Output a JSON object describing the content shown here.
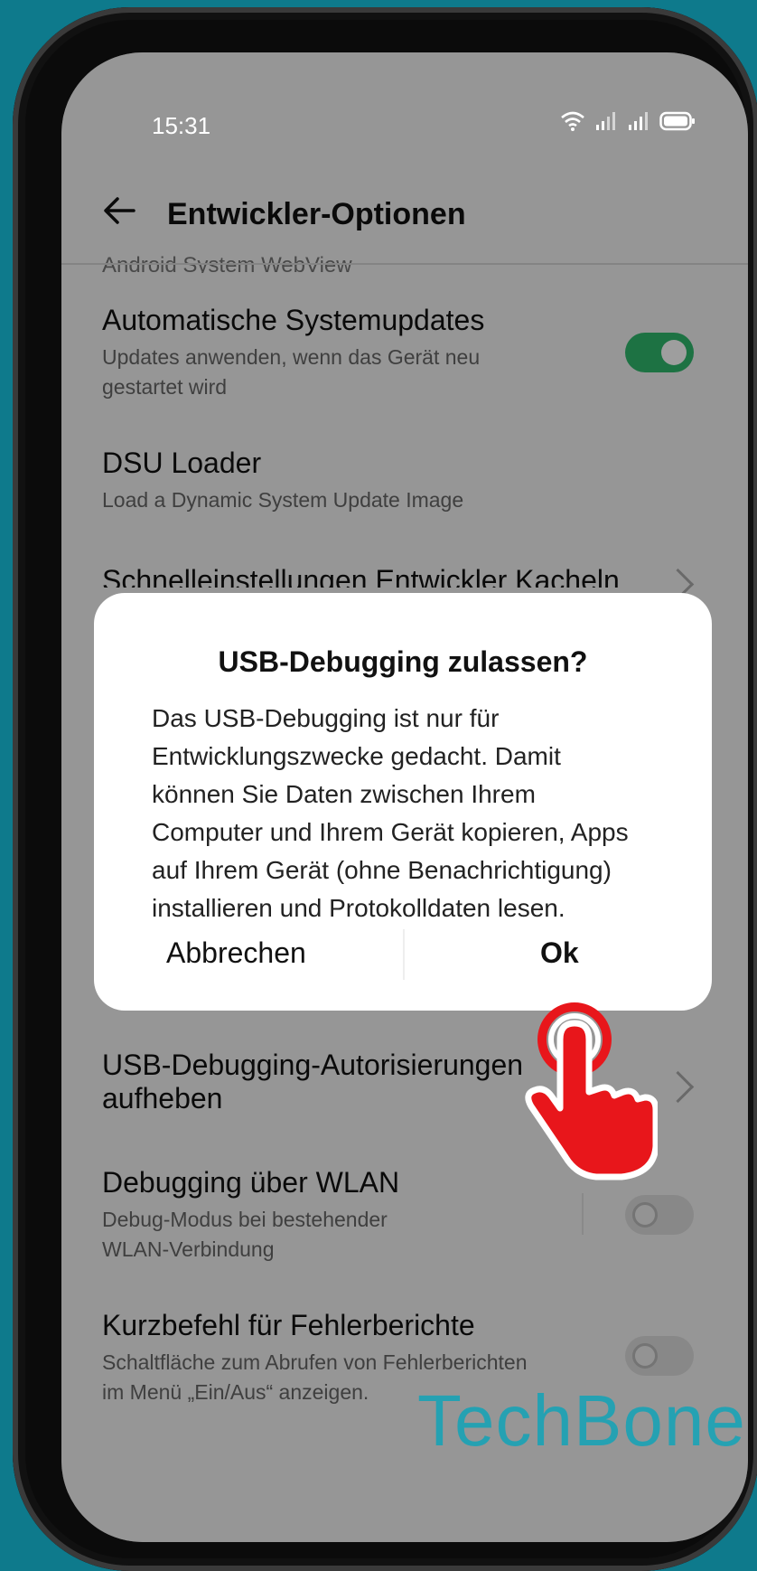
{
  "status_bar": {
    "time": "15:31"
  },
  "app_bar": {
    "title": "Entwickler-Optionen"
  },
  "behind_dialog": {
    "cut_label": "Android System WebView",
    "auto_updates": {
      "title": "Automatische Systemupdates",
      "subtitle_1": "Updates anwenden, wenn das Gerät neu",
      "subtitle_2": "gestartet wird",
      "state": "on"
    },
    "dsu": {
      "title": "DSU Loader",
      "subtitle": "Load a Dynamic System Update Image"
    },
    "quick_tiles": {
      "title": "Schnelleinstellungen Entwickler Kacheln"
    },
    "usb_revoke": {
      "title_1": "USB-Debugging-Autorisierungen",
      "title_2": "aufheben"
    },
    "wlan_debug": {
      "title": "Debugging über WLAN",
      "subtitle_1": "Debug-Modus bei bestehender",
      "subtitle_2": "WLAN-Verbindung",
      "state": "off"
    },
    "bugreport": {
      "title": "Kurzbefehl für Fehlerberichte",
      "subtitle_1": "Schaltfläche zum Abrufen von Fehlerberichten",
      "subtitle_2": "im Menü „Ein/Aus“ anzeigen.",
      "state": "off"
    }
  },
  "dialog": {
    "title": "USB-Debugging zulassen?",
    "body_lines": [
      "Das USB-Debugging ist nur für",
      "Entwicklungszwecke gedacht. Damit",
      "können Sie Daten zwischen Ihrem",
      "Computer und Ihrem Gerät kopieren, Apps",
      "auf Ihrem Gerät (ohne Benachrichtigung)",
      "installieren und Protokolldaten lesen."
    ],
    "cancel_label": "Abbrechen",
    "ok_label": "Ok"
  },
  "watermark": "TechBone",
  "colors": {
    "background": "#0e7a8c",
    "toggle_on": "#2fb86c",
    "hand": "#e8161b"
  }
}
